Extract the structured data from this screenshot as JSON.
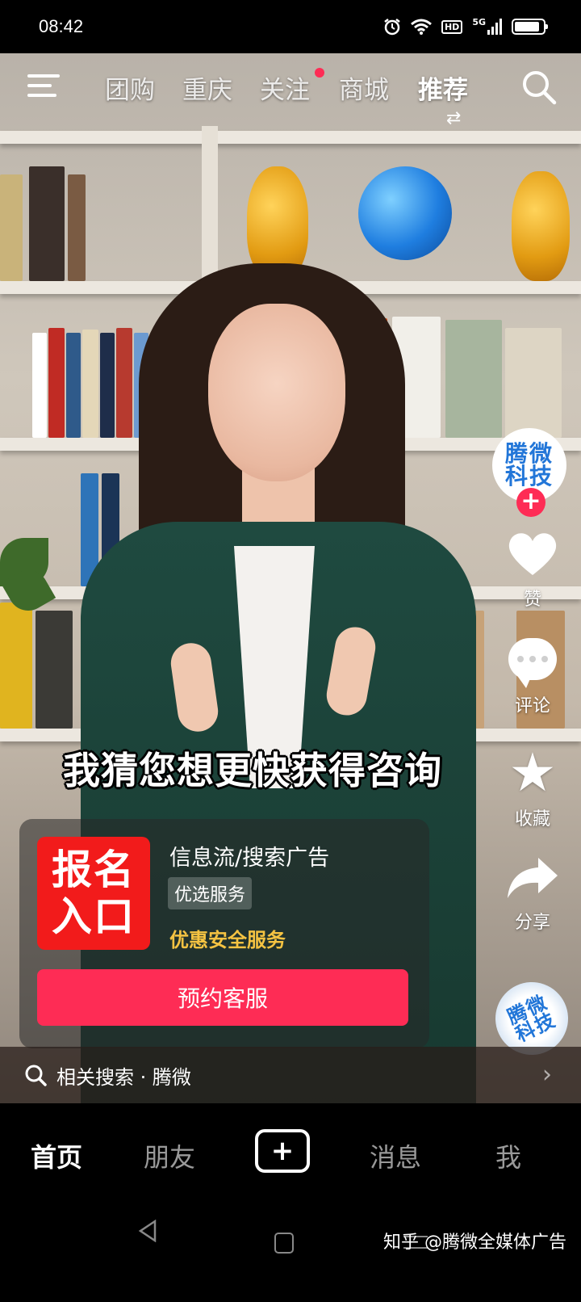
{
  "status_bar": {
    "time": "08:42",
    "icons": [
      "alarm-icon",
      "wifi-icon",
      "hd-icon",
      "5g-signal-icon",
      "battery-icon"
    ],
    "hd_label": "HD",
    "network_label": "5G"
  },
  "top_nav": {
    "tabs": [
      {
        "label": "团购"
      },
      {
        "label": "重庆"
      },
      {
        "label": "关注",
        "has_dot": true
      },
      {
        "label": "商城"
      },
      {
        "label": "推荐",
        "active": true
      }
    ],
    "swap_glyph": "⇄"
  },
  "creator": {
    "avatar_text": "腾微科技",
    "follow_glyph": "+"
  },
  "actions": {
    "like_label": "赞",
    "comment_label": "评论",
    "favorite_label": "收藏",
    "share_label": "分享"
  },
  "music_disc_text": "腾微科技",
  "caption": "我猜您想更快获得咨询",
  "ad": {
    "logo_line1": "报名",
    "logo_line2": "入口",
    "title": "信息流/搜索广告",
    "tag": "优选服务",
    "subtitle": "优惠安全服务",
    "button_label": "预约客服"
  },
  "related_search": {
    "text": "相关搜索 · 腾微",
    "chevron": "›"
  },
  "bottom_tabs": {
    "home": "首页",
    "friends": "朋友",
    "create_glyph": "+",
    "messages": "消息",
    "me": "我"
  },
  "system_nav": {
    "watermark": "知乎 @腾微全媒体广告"
  },
  "colors": {
    "accent": "#fe2c55",
    "ad_logo": "#f21b1b",
    "promo_yellow": "#f5c342"
  }
}
